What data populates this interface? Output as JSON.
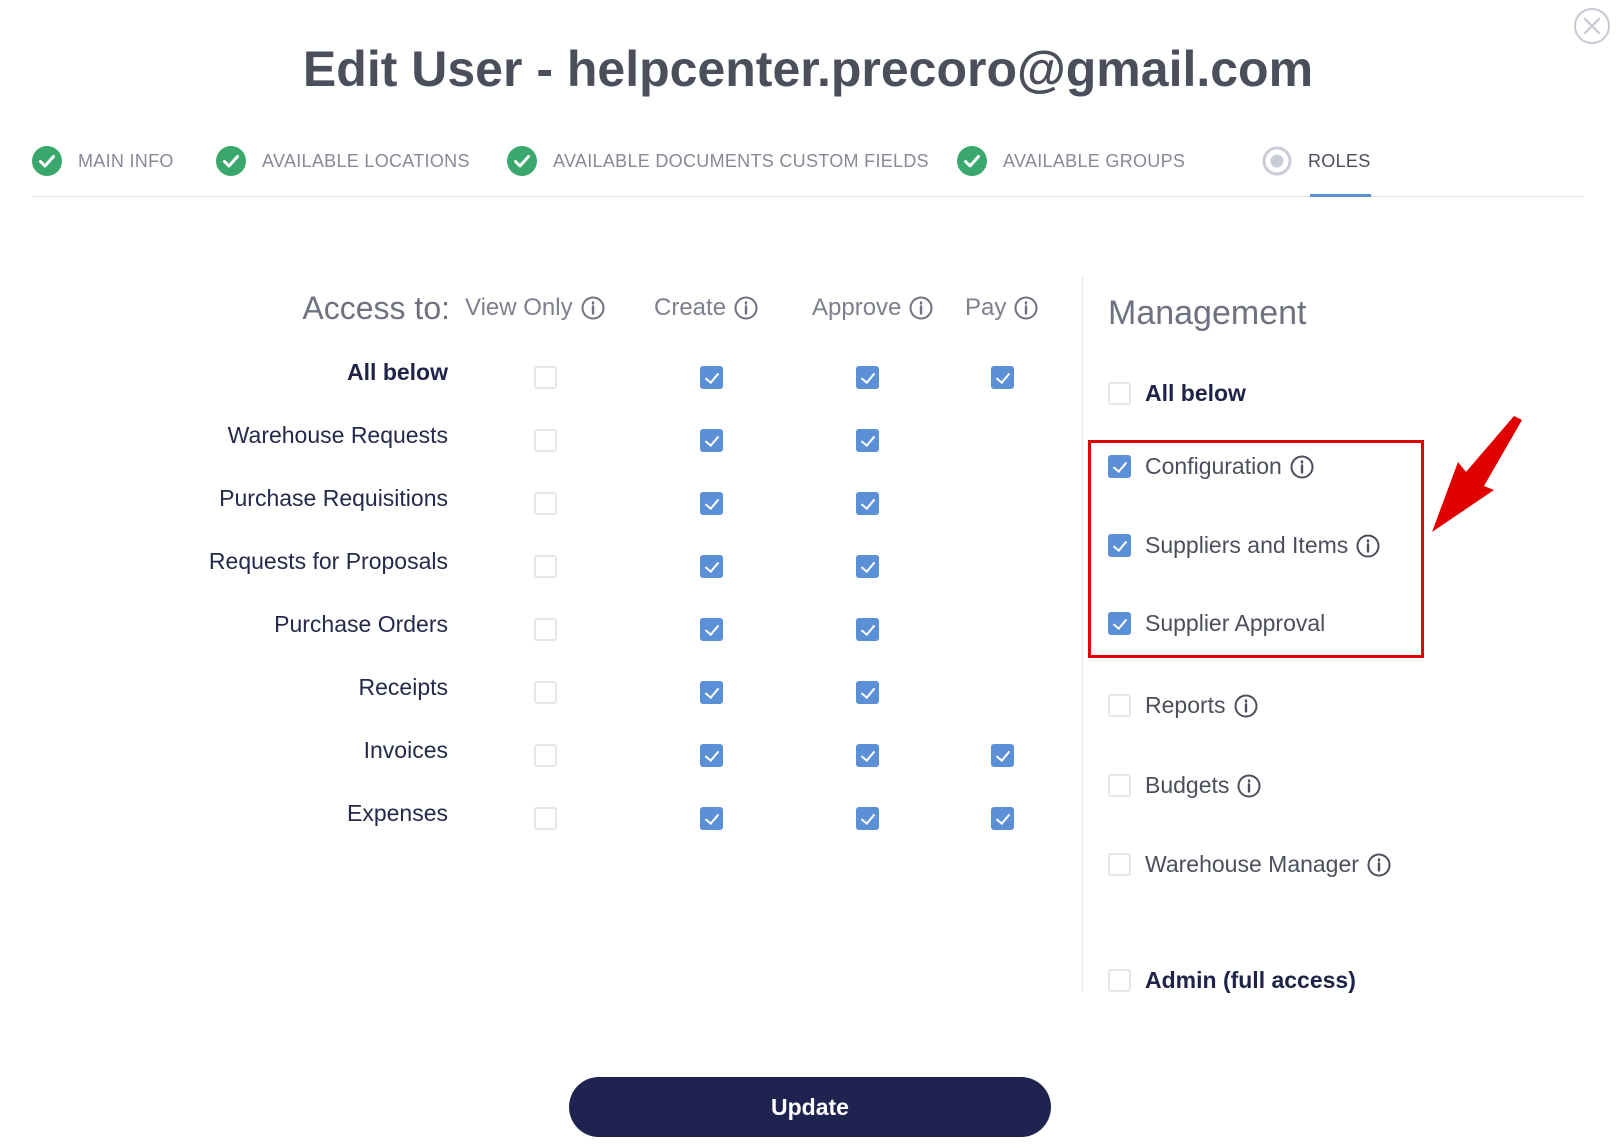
{
  "modal": {
    "title": "Edit User - helpcenter.precoro@gmail.com",
    "close_icon": "close-icon",
    "update_label": "Update"
  },
  "tabs": [
    {
      "label": "MAIN INFO",
      "status": "completed"
    },
    {
      "label": "AVAILABLE LOCATIONS",
      "status": "completed"
    },
    {
      "label": "AVAILABLE DOCUMENTS CUSTOM FIELDS",
      "status": "completed"
    },
    {
      "label": "AVAILABLE GROUPS",
      "status": "completed"
    },
    {
      "label": "ROLES",
      "status": "active"
    }
  ],
  "access": {
    "header_label": "Access to:",
    "columns": [
      "View Only",
      "Create",
      "Approve",
      "Pay"
    ],
    "rows": [
      {
        "label": "All below",
        "bold": true,
        "view_only": false,
        "create": true,
        "approve": true,
        "pay": true
      },
      {
        "label": "Warehouse Requests",
        "view_only": false,
        "create": true,
        "approve": true,
        "pay": null
      },
      {
        "label": "Purchase Requisitions",
        "view_only": false,
        "create": true,
        "approve": true,
        "pay": null
      },
      {
        "label": "Requests for Proposals",
        "view_only": false,
        "create": true,
        "approve": true,
        "pay": null
      },
      {
        "label": "Purchase Orders",
        "view_only": false,
        "create": true,
        "approve": true,
        "pay": null
      },
      {
        "label": "Receipts",
        "view_only": false,
        "create": true,
        "approve": true,
        "pay": null
      },
      {
        "label": "Invoices",
        "view_only": false,
        "create": true,
        "approve": true,
        "pay": true
      },
      {
        "label": "Expenses",
        "view_only": false,
        "create": true,
        "approve": true,
        "pay": true
      }
    ]
  },
  "management": {
    "title": "Management",
    "items": [
      {
        "label": "All below",
        "checked": false,
        "bold": true,
        "info": false
      },
      {
        "label": "Configuration",
        "checked": true,
        "info": true
      },
      {
        "label": "Suppliers and Items",
        "checked": true,
        "info": true
      },
      {
        "label": "Supplier Approval",
        "checked": true,
        "info": false
      },
      {
        "label": "Reports",
        "checked": false,
        "info": true
      },
      {
        "label": "Budgets",
        "checked": false,
        "info": true
      },
      {
        "label": "Warehouse Manager",
        "checked": false,
        "info": true
      },
      {
        "label": "Admin (full access)",
        "checked": false,
        "bold": true,
        "info": false
      }
    ]
  },
  "colors": {
    "accent": "#5b8fd6",
    "success": "#3aa76d",
    "primary_button": "#1f2350",
    "annotation": "#e00000"
  }
}
